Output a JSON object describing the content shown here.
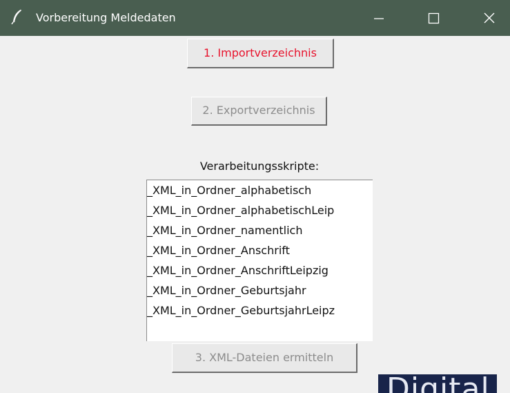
{
  "window": {
    "title": "Vorbereitung Meldedaten",
    "icon": "feather-icon"
  },
  "buttons": {
    "import": "1. Importverzeichnis",
    "export": "2. Exportverzeichnis",
    "xml": "3. XML-Dateien ermitteln"
  },
  "scripts": {
    "label": "Verarbeitungsskripte:",
    "items": [
      "_XML_in_Ordner_alphabetisch",
      "_XML_in_Ordner_alphabetischLeip",
      "_XML_in_Ordner_namentlich",
      "_XML_in_Ordner_Anschrift",
      "_XML_in_Ordner_AnschriftLeipzig",
      "_XML_in_Ordner_Geburtsjahr",
      "_XML_in_Ordner_GeburtsjahrLeipz"
    ]
  },
  "corner_logo": "Digital",
  "colors": {
    "titlebar": "#495e50",
    "import_text": "#e8122c",
    "disabled_text": "#8c8c8c",
    "window_bg": "#f0f0f0"
  }
}
